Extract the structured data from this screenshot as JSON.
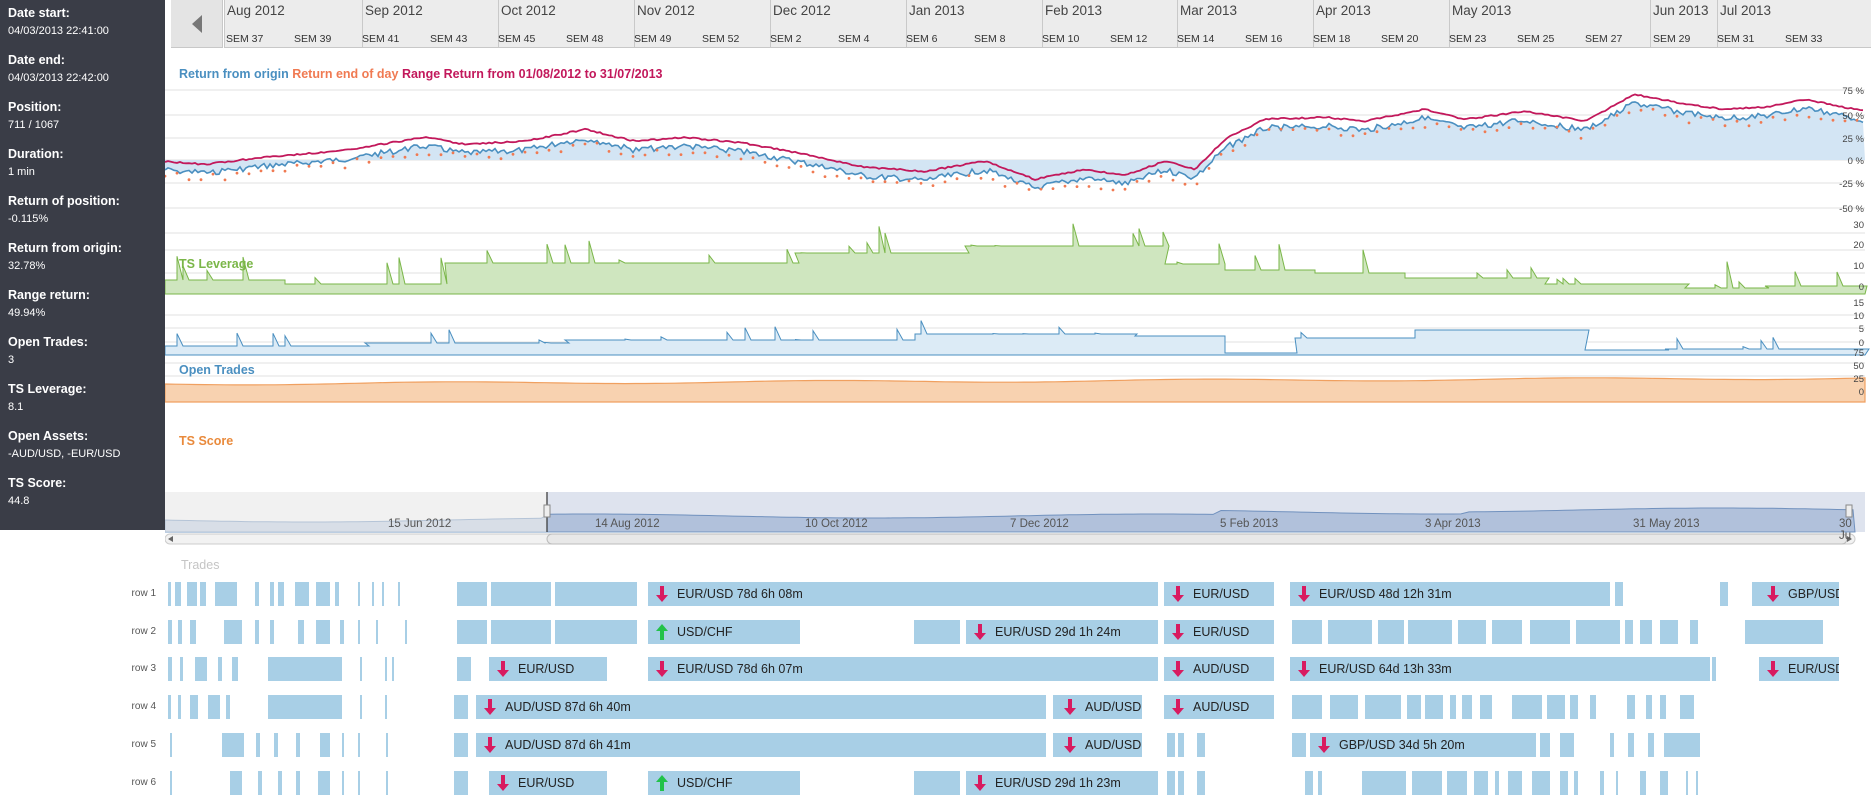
{
  "info_panel": {
    "rows": [
      {
        "label": "Date start:",
        "value": "04/03/2013 22:41:00"
      },
      {
        "label": "Date end:",
        "value": "04/03/2013 22:42:00"
      },
      {
        "label": "Position:",
        "value": "711 / 1067"
      },
      {
        "label": "Duration:",
        "value": "1 min"
      },
      {
        "label": "Return of position:",
        "value": "-0.115%"
      },
      {
        "label": "Return from origin:",
        "value": "32.78%"
      },
      {
        "label": "Range return:",
        "value": "49.94%"
      },
      {
        "label": "Open Trades:",
        "value": "3"
      },
      {
        "label": "TS Leverage:",
        "value": "8.1"
      },
      {
        "label": "Open Assets:",
        "value": "-AUD/USD, -EUR/USD"
      },
      {
        "label": "TS Score:",
        "value": "44.8"
      }
    ]
  },
  "timeline": {
    "months": [
      "Aug 2012",
      "Sep 2012",
      "Oct 2012",
      "Nov 2012",
      "Dec 2012",
      "Jan 2013",
      "Feb 2013",
      "Mar 2013",
      "Apr 2013",
      "May 2013",
      "Jun 2013",
      "Jul 2013"
    ],
    "weeks": [
      "SEM 37",
      "SEM 39",
      "SEM 41",
      "SEM 43",
      "SEM 45",
      "SEM 48",
      "SEM 49",
      "SEM 52",
      "SEM 2",
      "SEM 4",
      "SEM 6",
      "SEM 8",
      "SEM 10",
      "SEM 12",
      "SEM 14",
      "SEM 16",
      "SEM 18",
      "SEM 20",
      "SEM 23",
      "SEM 25",
      "SEM 27",
      "SEM 29",
      "SEM 31",
      "SEM 33"
    ]
  },
  "charts": {
    "returns": {
      "legend": {
        "return_from_origin": "Return from origin",
        "return_end_of_day": "Return end of day",
        "range_return": "Range Return from 01/08/2012 to 31/07/2013"
      },
      "y_ticks": [
        "75 %",
        "50 %",
        "25 %",
        "0 %",
        "-25 %",
        "-50 %"
      ]
    },
    "leverage": {
      "title": "TS Leverage",
      "y_ticks": [
        "30",
        "20",
        "10",
        "0"
      ]
    },
    "open_trades": {
      "title": "Open Trades",
      "y_ticks": [
        "15",
        "10",
        "5",
        "0"
      ]
    },
    "score": {
      "title": "TS Score",
      "y_ticks": [
        "75",
        "50",
        "25",
        "0"
      ]
    },
    "colors": {
      "return_from_origin": "#4a8fc0",
      "return_end_of_day": "#f07a52",
      "range_return": "#c2185b",
      "leverage": "#7ab648",
      "open_trades": "#4a8fc0",
      "score": "#f0a060"
    }
  },
  "navigator": {
    "dates": [
      "15 Jun 2012",
      "14 Aug 2012",
      "10 Oct 2012",
      "7 Dec 2012",
      "5 Feb 2013",
      "3 Apr 2013",
      "31 May 2013",
      "30 Ju"
    ]
  },
  "trades": {
    "title": "Trades",
    "rows": [
      "row 1",
      "row 2",
      "row 3",
      "row 4",
      "row 5",
      "row 6"
    ],
    "labeled": [
      {
        "label": "EUR/USD 78d 6h 08m",
        "dir": "down"
      },
      {
        "label": "EUR/USD",
        "dir": "down"
      },
      {
        "label": "EUR/USD 48d 12h 31m",
        "dir": "down"
      },
      {
        "label": "GBP/USD",
        "dir": "down"
      },
      {
        "label": "USD/CHF",
        "dir": "up"
      },
      {
        "label": "EUR/USD 29d 1h 24m",
        "dir": "down"
      },
      {
        "label": "EUR/USD",
        "dir": "down"
      },
      {
        "label": "EUR/USD",
        "dir": "down"
      },
      {
        "label": "EUR/USD 78d 6h 07m",
        "dir": "down"
      },
      {
        "label": "AUD/USD",
        "dir": "down"
      },
      {
        "label": "EUR/USD 64d 13h 33m",
        "dir": "down"
      },
      {
        "label": "EUR/USD",
        "dir": "down"
      },
      {
        "label": "AUD/USD 87d 6h 40m",
        "dir": "down"
      },
      {
        "label": "AUD/USD",
        "dir": "down"
      },
      {
        "label": "AUD/USD",
        "dir": "down"
      },
      {
        "label": "AUD/USD 87d 6h 41m",
        "dir": "down"
      },
      {
        "label": "AUD/USD",
        "dir": "down"
      },
      {
        "label": "GBP/USD 34d 5h 20m",
        "dir": "down"
      },
      {
        "label": "EUR/USD",
        "dir": "down"
      },
      {
        "label": "USD/CHF",
        "dir": "up"
      },
      {
        "label": "EUR/USD 29d 1h 23m",
        "dir": "down"
      }
    ]
  }
}
